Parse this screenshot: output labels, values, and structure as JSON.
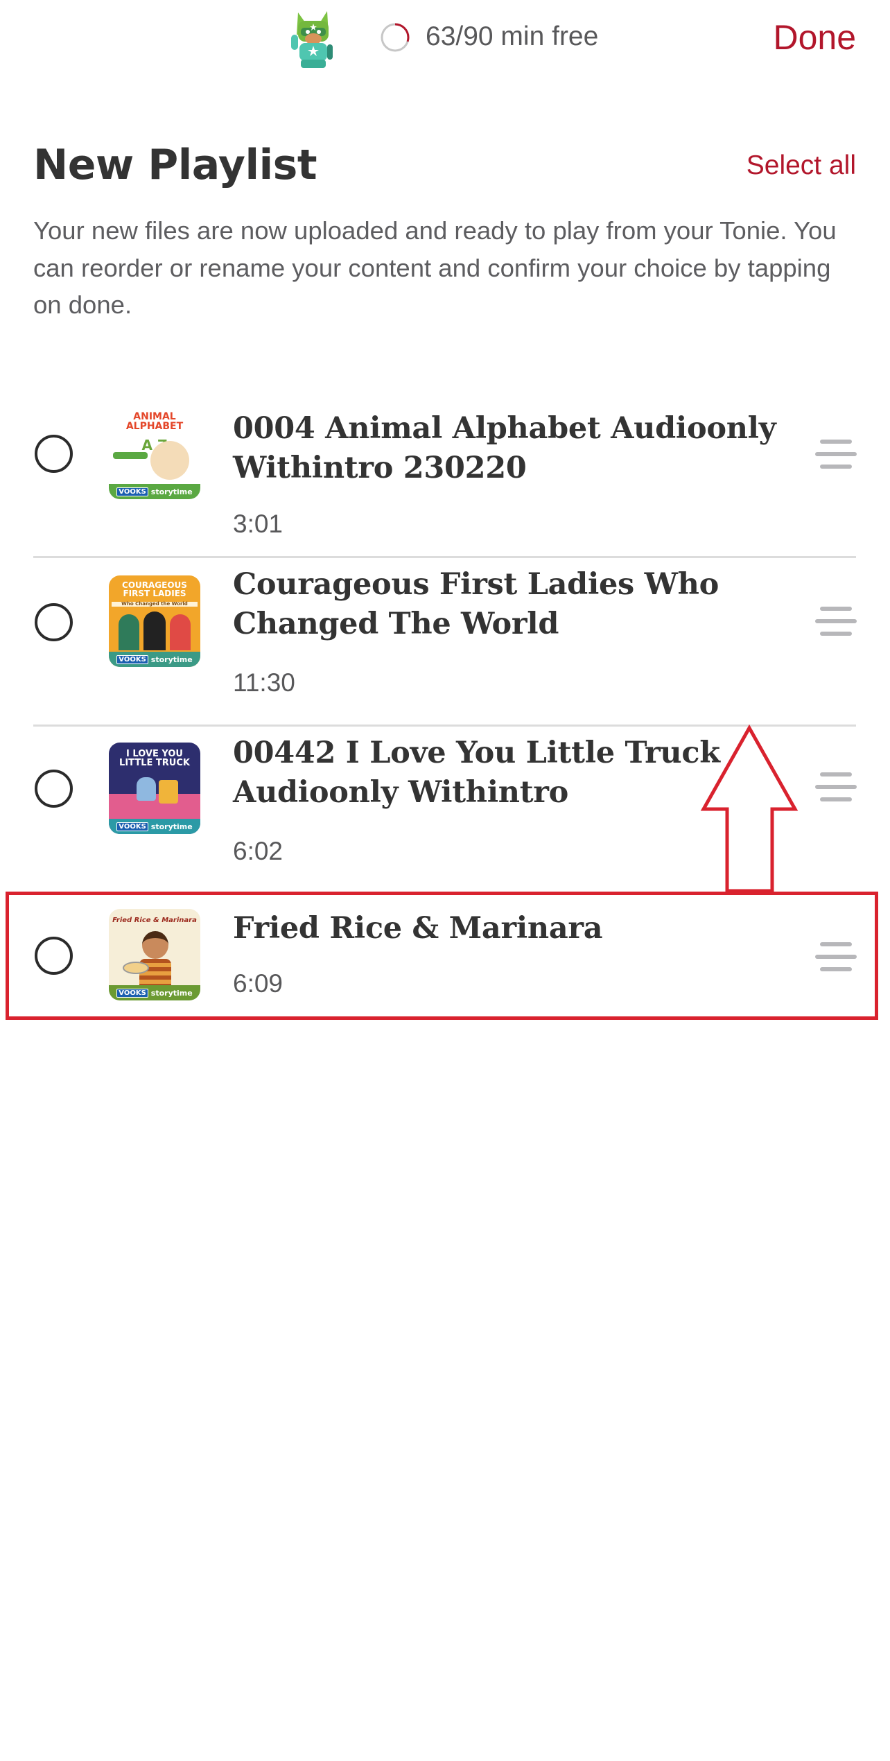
{
  "header": {
    "tonie_icon": "creative-tonie-figure-icon",
    "storage": {
      "text": "63/90 min free",
      "free_minutes": 63,
      "total_minutes": 90,
      "used_fraction": 0.3,
      "ring_color": "#b2162b",
      "track_color": "#c7c7c7"
    },
    "done_label": "Done"
  },
  "page": {
    "title": "New Playlist",
    "select_all_label": "Select all",
    "description": "Your new files are now uploaded and ready to play from your Tonie. You can reorder or rename your content and confirm your choice by tapping on done."
  },
  "playlist": {
    "items": [
      {
        "title": "0004 Animal Alphabet Audioonly Withintro 230220",
        "duration": "3:01",
        "selected": false,
        "thumb": {
          "label": "ANIMAL ALPHABET",
          "sub": "A   Z",
          "bg": "#ffffff",
          "band": "#5aa842",
          "brand": "storytime",
          "brand_badge": "VOOKS"
        }
      },
      {
        "title": "Courageous First Ladies Who Changed The World",
        "duration": "11:30",
        "selected": false,
        "thumb": {
          "label": "COURAGEOUS FIRST LADIES",
          "sub": "Who Changed the World",
          "bg": "#f2a62a",
          "band": "#3b9a86",
          "brand": "storytime",
          "brand_badge": "VOOKS"
        }
      },
      {
        "title": "00442 I Love You Little Truck Audioonly Withintro",
        "duration": "6:02",
        "selected": false,
        "thumb": {
          "label": "I LOVE YOU LITTLE TRUCK",
          "sub": "",
          "bg": "#2d2e6e",
          "band": "#2b9aa6",
          "brand": "storytime",
          "brand_badge": "VOOKS"
        }
      },
      {
        "title": "Fried Rice & Marinara",
        "duration": "6:09",
        "selected": false,
        "thumb": {
          "label": "Fried Rice & Marinara",
          "sub": "",
          "bg": "#f6eed8",
          "band": "#6b9a32",
          "brand": "storytime",
          "brand_badge": "VOOKS"
        }
      }
    ]
  },
  "annotation": {
    "highlighted_item_index": 3,
    "arrow_direction": "up",
    "color": "#d9222e"
  }
}
